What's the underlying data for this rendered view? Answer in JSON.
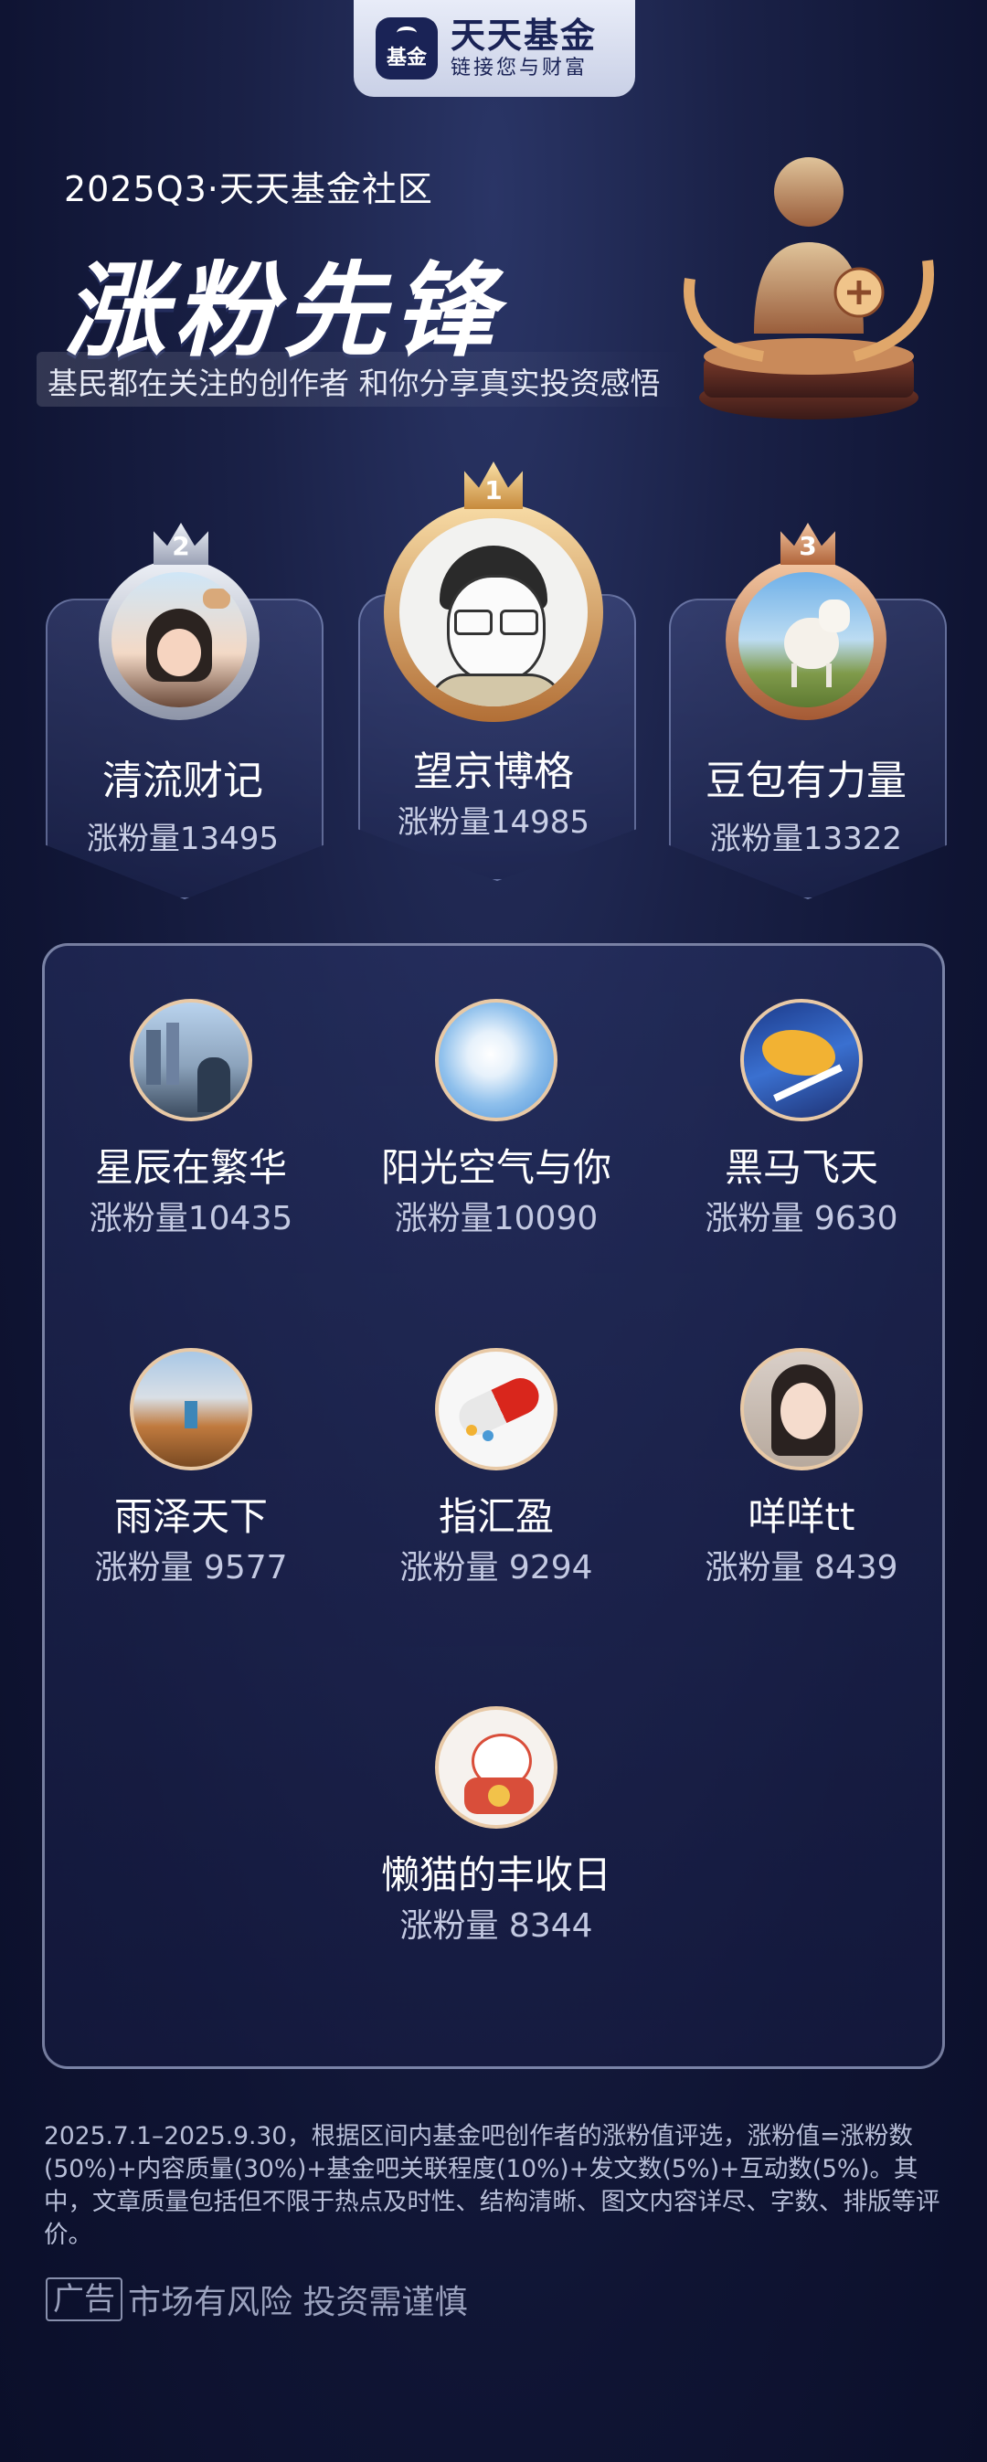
{
  "brand": {
    "mark": "基金",
    "name": "天天基金",
    "slogan": "链接您与财富"
  },
  "header": {
    "period": "2025Q3·天天基金社区",
    "title": "涨粉先锋",
    "subtitle": "基民都在关注的创作者 和你分享真实投资感悟"
  },
  "podium": [
    {
      "rank": "2",
      "name": "清流财记",
      "followers": "涨粉量13495"
    },
    {
      "rank": "1",
      "name": "望京博格",
      "followers": "涨粉量14985"
    },
    {
      "rank": "3",
      "name": "豆包有力量",
      "followers": "涨粉量13322"
    }
  ],
  "list": [
    {
      "name": "星辰在繁华",
      "followers": "涨粉量10435"
    },
    {
      "name": "阳光空气与你",
      "followers": "涨粉量10090"
    },
    {
      "name": "黑马飞天",
      "followers": "涨粉量 9630"
    },
    {
      "name": "雨泽天下",
      "followers": "涨粉量 9577"
    },
    {
      "name": "指汇盈",
      "followers": "涨粉量 9294"
    },
    {
      "name": "咩咩tt",
      "followers": "涨粉量 8439"
    },
    {
      "name": "懒猫的丰收日",
      "followers": "涨粉量 8344"
    }
  ],
  "footer": {
    "note": "2025.7.1–2025.9.30，根据区间内基金吧创作者的涨粉值评选，涨粉值=涨粉数(50%)+内容质量(30%)+基金吧关联程度(10%)+发文数(5%)+互动数(5%)。其中，文章质量包括但不限于热点及时性、结构清晰、图文内容详尽、字数、排版等评价。",
    "ad_label": "广告",
    "risk_warning": "市场有风险 投资需谨慎"
  },
  "colors": {
    "gold": "#d9a45c",
    "silver": "#c6cbd8",
    "bronze": "#d08a5c",
    "background": "#141a3d"
  }
}
